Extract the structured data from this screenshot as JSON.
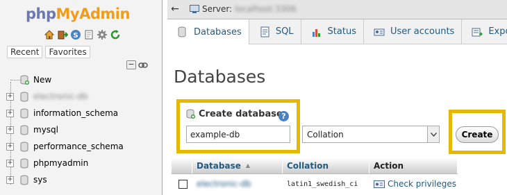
{
  "nav": {
    "logo_php": "php",
    "logo_myadmin": "MyAdmin",
    "icons": [
      "home-icon",
      "exit-icon",
      "query-window-icon",
      "documentation-icon",
      "settings-icon",
      "reload-icon"
    ],
    "tabs": [
      "Recent",
      "Favorites"
    ],
    "collapse_label": "−",
    "tree": [
      {
        "label": "New",
        "kind": "new"
      },
      {
        "label": "electronic-db",
        "kind": "db",
        "blurred": true
      },
      {
        "label": "information_schema",
        "kind": "db"
      },
      {
        "label": "mysql",
        "kind": "db"
      },
      {
        "label": "performance_schema",
        "kind": "db"
      },
      {
        "label": "phpmyadmin",
        "kind": "db"
      },
      {
        "label": "sys",
        "kind": "db"
      }
    ]
  },
  "topbar": {
    "back_label": "←",
    "server_label": "Server:",
    "server_value": "localhost:3306"
  },
  "tabs": [
    {
      "label": "Databases",
      "icon": "database-icon",
      "active": true
    },
    {
      "label": "SQL",
      "icon": "sql-icon"
    },
    {
      "label": "Status",
      "icon": "status-icon"
    },
    {
      "label": "User accounts",
      "icon": "user-accounts-icon"
    },
    {
      "label": "Expor",
      "icon": "export-icon"
    }
  ],
  "page": {
    "title": "Databases",
    "create_label": "Create database",
    "help_label": "?",
    "dbname_value": "example-db",
    "collation_value": "Collation",
    "create_button": "Create",
    "highlight_color": "#e6b800"
  },
  "table": {
    "headers": {
      "database": "Database",
      "sort_marker": "▲",
      "collation": "Collation",
      "action": "Action"
    },
    "rows": [
      {
        "database": "electronic-db",
        "collation": "latin1_swedish_ci",
        "action": "Check privileges"
      }
    ]
  },
  "colors": {
    "link": "#235a81",
    "accent": "#f29c1b",
    "logo_php": "#6c78af"
  }
}
